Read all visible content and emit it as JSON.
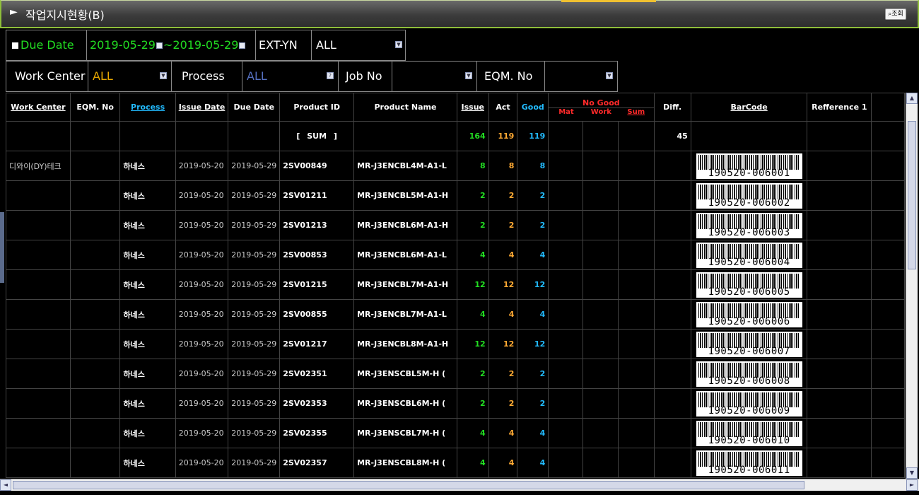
{
  "title": {
    "arrow": "►",
    "text": "작업지시현황(B)",
    "search_label": "조회"
  },
  "filters": {
    "due_date_label": "Due Date",
    "date_from": "2019-05-29",
    "date_sep": "~",
    "date_to": "2019-05-29",
    "ext_label": "EXT-YN",
    "ext_value": "ALL",
    "work_center_label": "Work Center",
    "work_center_value": "ALL",
    "process_label": "Process",
    "process_value": "ALL",
    "job_no_label": "Job No",
    "job_no_value": "",
    "eqm_label": "EQM. No",
    "eqm_value": ""
  },
  "grid": {
    "columns": [
      "Work Center",
      "EQM. No",
      "Process",
      "Issue Date",
      "Due Date",
      "Product ID",
      "Product Name",
      "Issue",
      "Act",
      "Good",
      "No Good",
      "Diff.",
      "BarCode",
      "Refference 1"
    ],
    "no_good_sub": [
      "Mat",
      "Work",
      "Sum"
    ],
    "sum_row": {
      "label": "[ SUM ]",
      "issue": "164",
      "act": "119",
      "good": "119",
      "diff": "45"
    },
    "rows": [
      {
        "work_center": "디와이(DY)테크",
        "process": "하네스",
        "issue_date": "2019-05-20",
        "due_date": "2019-05-29",
        "product_id": "2SV00849",
        "product_name": "MR-J3ENCBL4M-A1-L",
        "issue": "8",
        "act": "8",
        "good": "8",
        "barcode": "190520-006001"
      },
      {
        "work_center": "",
        "process": "하네스",
        "issue_date": "2019-05-20",
        "due_date": "2019-05-29",
        "product_id": "2SV01211",
        "product_name": "MR-J3ENCBL5M-A1-H",
        "issue": "2",
        "act": "2",
        "good": "2",
        "barcode": "190520-006002"
      },
      {
        "work_center": "",
        "process": "하네스",
        "issue_date": "2019-05-20",
        "due_date": "2019-05-29",
        "product_id": "2SV01213",
        "product_name": "MR-J3ENCBL6M-A1-H",
        "issue": "2",
        "act": "2",
        "good": "2",
        "barcode": "190520-006003"
      },
      {
        "work_center": "",
        "process": "하네스",
        "issue_date": "2019-05-20",
        "due_date": "2019-05-29",
        "product_id": "2SV00853",
        "product_name": "MR-J3ENCBL6M-A1-L",
        "issue": "4",
        "act": "4",
        "good": "4",
        "barcode": "190520-006004"
      },
      {
        "work_center": "",
        "process": "하네스",
        "issue_date": "2019-05-20",
        "due_date": "2019-05-29",
        "product_id": "2SV01215",
        "product_name": "MR-J3ENCBL7M-A1-H",
        "issue": "12",
        "act": "12",
        "good": "12",
        "barcode": "190520-006005"
      },
      {
        "work_center": "",
        "process": "하네스",
        "issue_date": "2019-05-20",
        "due_date": "2019-05-29",
        "product_id": "2SV00855",
        "product_name": "MR-J3ENCBL7M-A1-L",
        "issue": "4",
        "act": "4",
        "good": "4",
        "barcode": "190520-006006"
      },
      {
        "work_center": "",
        "process": "하네스",
        "issue_date": "2019-05-20",
        "due_date": "2019-05-29",
        "product_id": "2SV01217",
        "product_name": "MR-J3ENCBL8M-A1-H",
        "issue": "12",
        "act": "12",
        "good": "12",
        "barcode": "190520-006007"
      },
      {
        "work_center": "",
        "process": "하네스",
        "issue_date": "2019-05-20",
        "due_date": "2019-05-29",
        "product_id": "2SV02351",
        "product_name": "MR-J3ENSCBL5M-H (",
        "issue": "2",
        "act": "2",
        "good": "2",
        "barcode": "190520-006008"
      },
      {
        "work_center": "",
        "process": "하네스",
        "issue_date": "2019-05-20",
        "due_date": "2019-05-29",
        "product_id": "2SV02353",
        "product_name": "MR-J3ENSCBL6M-H (",
        "issue": "2",
        "act": "2",
        "good": "2",
        "barcode": "190520-006009"
      },
      {
        "work_center": "",
        "process": "하네스",
        "issue_date": "2019-05-20",
        "due_date": "2019-05-29",
        "product_id": "2SV02355",
        "product_name": "MR-J3ENSCBL7M-H (",
        "issue": "4",
        "act": "4",
        "good": "4",
        "barcode": "190520-006010"
      },
      {
        "work_center": "",
        "process": "하네스",
        "issue_date": "2019-05-20",
        "due_date": "2019-05-29",
        "product_id": "2SV02357",
        "product_name": "MR-J3ENSCBL8M-H (",
        "issue": "4",
        "act": "4",
        "good": "4",
        "barcode": "190520-006011"
      }
    ]
  },
  "scrollbars": {
    "up_arrow": "▲",
    "down_arrow": "▼",
    "left_arrow": "◄",
    "right_arrow": "►"
  },
  "colors": {
    "accent_green": "#8fbf3a",
    "issue": "#22dd22",
    "act": "#ffaa33",
    "good": "#22bbff",
    "no_good": "#ff2a2a"
  }
}
